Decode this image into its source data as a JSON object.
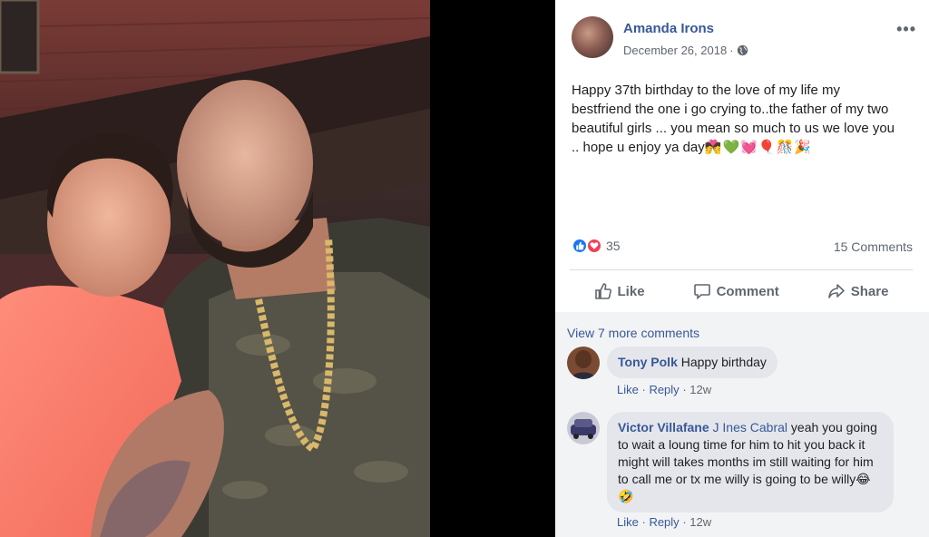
{
  "post": {
    "author": "Amanda Irons",
    "date": "December 26, 2018",
    "separator": "·",
    "more": "•••",
    "text": "Happy 37th birthday to the love of my life my bestfriend the one i go crying to..the father of my two beautiful girls ... you mean so much to us we love you .. hope u enjoy ya day",
    "emojis": "💏💚💓🎈🎊🎉"
  },
  "reactions": {
    "count": "35",
    "comments_count": "15 Comments",
    "icons": [
      "like-icon",
      "love-icon"
    ]
  },
  "actions": {
    "like": "Like",
    "comment": "Comment",
    "share": "Share"
  },
  "comments": {
    "view_more": "View 7 more comments",
    "items": [
      {
        "name": "Tony Polk",
        "text": "Happy birthday",
        "like": "Like",
        "reply": "Reply",
        "time": "12w"
      },
      {
        "name": "Victor Villafane",
        "tag": "J Ines Cabral",
        "text": "yeah you going to wait a loung time for him to hit you back it might will takes months im still waiting for him to call me or tx me willy is going to be willy😂🤣",
        "like": "Like",
        "reply": "Reply",
        "time": "12w"
      }
    ]
  },
  "colors": {
    "link": "#385898",
    "secondary": "#606770",
    "comment_bg": "#e4e6eb",
    "like_blue": "#1877f2",
    "love_red": "#f33e58"
  }
}
